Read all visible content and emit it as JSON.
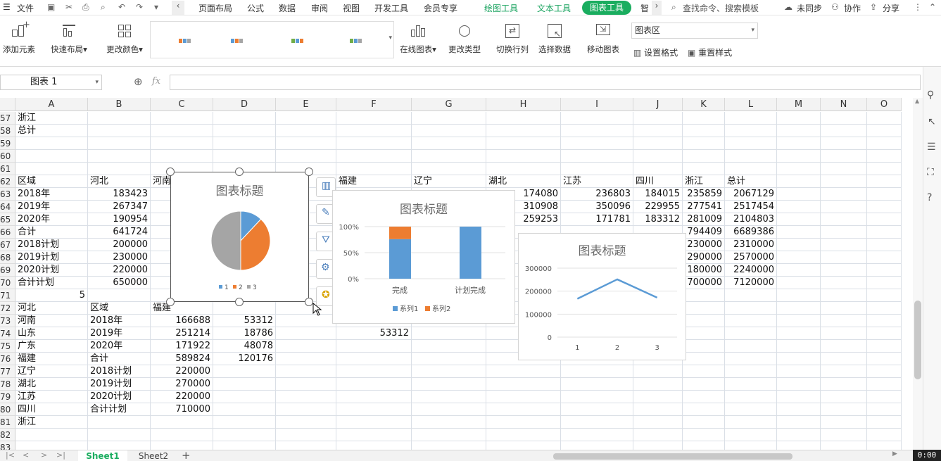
{
  "menubar": {
    "file": "文件",
    "tabs": [
      "页面布局",
      "公式",
      "数据",
      "审阅",
      "视图",
      "开发工具",
      "会员专享"
    ],
    "context_tabs": [
      "绘图工具",
      "文本工具"
    ],
    "active_context_tab": "图表工具",
    "more_tab": "智",
    "search_placeholder": "查找命令、搜索模板",
    "sync": "未同步",
    "collab": "协作",
    "share": "分享"
  },
  "ribbon": {
    "add_element": "添加元素",
    "quick_layout": "快速布局",
    "change_color": "更改颜色",
    "online_chart": "在线图表",
    "change_type": "更改类型",
    "switch_row_col": "切换行列",
    "select_data": "选择数据",
    "move_chart": "移动图表",
    "chart_area_select": "图表区",
    "set_format": "设置格式",
    "reset_style": "重置样式"
  },
  "formula": {
    "namebox": "图表 1",
    "fx": "fx"
  },
  "columns": [
    "A",
    "B",
    "C",
    "D",
    "E",
    "F",
    "G",
    "H",
    "I",
    "J",
    "K",
    "L",
    "M",
    "N",
    "O"
  ],
  "rows": [
    {
      "n": "57",
      "cells": [
        "浙江",
        "",
        "",
        "",
        "",
        "",
        "",
        "",
        "",
        "",
        "",
        ""
      ]
    },
    {
      "n": "58",
      "cells": [
        "总计",
        "",
        "",
        "",
        "",
        "",
        "",
        "",
        "",
        "",
        "",
        ""
      ]
    },
    {
      "n": "59",
      "cells": [
        "",
        "",
        "",
        "",
        "",
        "",
        "",
        "",
        "",
        "",
        "",
        ""
      ]
    },
    {
      "n": "60",
      "cells": [
        "",
        "",
        "",
        "",
        "",
        "",
        "",
        "",
        "",
        "",
        "",
        ""
      ]
    },
    {
      "n": "61",
      "cells": [
        "",
        "",
        "",
        "",
        "",
        "",
        "",
        "",
        "",
        "",
        "",
        ""
      ]
    },
    {
      "n": "62",
      "cells": [
        "区域",
        "河北",
        "河南",
        "",
        "",
        "福建",
        "辽宁",
        "湖北",
        "江苏",
        "四川",
        "浙江",
        "总计"
      ]
    },
    {
      "n": "63",
      "cells": [
        "2018年",
        "183423",
        "",
        "",
        "",
        "",
        "",
        "174080",
        "236803",
        "184015",
        "235859",
        "2067129"
      ]
    },
    {
      "n": "64",
      "cells": [
        "2019年",
        "267347",
        "",
        "",
        "",
        "",
        "",
        "310908",
        "350096",
        "229955",
        "277541",
        "2517454"
      ]
    },
    {
      "n": "65",
      "cells": [
        "2020年",
        "190954",
        "",
        "",
        "",
        "",
        "",
        "259253",
        "171781",
        "183312",
        "281009",
        "2104803"
      ]
    },
    {
      "n": "66",
      "cells": [
        "合计",
        "641724",
        "",
        "",
        "",
        "",
        "",
        "",
        "",
        "",
        "794409",
        "6689386"
      ]
    },
    {
      "n": "67",
      "cells": [
        "2018计划",
        "200000",
        "",
        "",
        "",
        "",
        "",
        "",
        "",
        "",
        "230000",
        "2310000"
      ]
    },
    {
      "n": "68",
      "cells": [
        "2019计划",
        "230000",
        "",
        "",
        "",
        "",
        "",
        "",
        "",
        "",
        "290000",
        "2570000"
      ]
    },
    {
      "n": "69",
      "cells": [
        "2020计划",
        "220000",
        "",
        "",
        "",
        "",
        "",
        "",
        "",
        "",
        "180000",
        "2240000"
      ]
    },
    {
      "n": "70",
      "cells": [
        "合计计划",
        "650000",
        "",
        "",
        "",
        "",
        "",
        "",
        "",
        "",
        "700000",
        "7120000"
      ]
    },
    {
      "n": "71",
      "cells": [
        "5",
        "",
        "",
        "",
        "",
        "",
        "",
        "",
        "",
        "",
        "",
        ""
      ]
    },
    {
      "n": "72",
      "cells": [
        "河北",
        "区域",
        "福建",
        "",
        "",
        "",
        "",
        "",
        "",
        "",
        "",
        ""
      ]
    },
    {
      "n": "73",
      "cells": [
        "河南",
        "2018年",
        "166688",
        "53312",
        "",
        "",
        "",
        "",
        "",
        "",
        "",
        ""
      ]
    },
    {
      "n": "74",
      "cells": [
        "山东",
        "2019年",
        "251214",
        "18786",
        "",
        "53312",
        "",
        "",
        "",
        "",
        "",
        ""
      ]
    },
    {
      "n": "75",
      "cells": [
        "广东",
        "2020年",
        "171922",
        "48078",
        "",
        "",
        "",
        "",
        "",
        "",
        "",
        ""
      ]
    },
    {
      "n": "76",
      "cells": [
        "福建",
        "合计",
        "589824",
        "120176",
        "",
        "",
        "",
        "",
        "",
        "",
        "",
        ""
      ]
    },
    {
      "n": "77",
      "cells": [
        "辽宁",
        "2018计划",
        "220000",
        "",
        "",
        "",
        "",
        "",
        "",
        "",
        "",
        ""
      ]
    },
    {
      "n": "78",
      "cells": [
        "湖北",
        "2019计划",
        "270000",
        "",
        "",
        "",
        "",
        "",
        "",
        "",
        "",
        ""
      ]
    },
    {
      "n": "79",
      "cells": [
        "江苏",
        "2020计划",
        "220000",
        "",
        "",
        "",
        "",
        "",
        "",
        "",
        "",
        ""
      ]
    },
    {
      "n": "80",
      "cells": [
        "四川",
        "合计计划",
        "710000",
        "",
        "",
        "",
        "",
        "",
        "",
        "",
        "",
        ""
      ]
    },
    {
      "n": "81",
      "cells": [
        "浙江",
        "",
        "",
        "",
        "",
        "",
        "",
        "",
        "",
        "",
        "",
        ""
      ]
    },
    {
      "n": "82",
      "cells": [
        "",
        "",
        "",
        "",
        "",
        "",
        "",
        "",
        "",
        "",
        "",
        ""
      ]
    },
    {
      "n": "83",
      "cells": [
        "",
        "",
        "",
        "",
        "",
        "",
        "",
        "",
        "",
        "",
        "",
        ""
      ]
    }
  ],
  "sheets": {
    "active": "Sheet1",
    "other": "Sheet2",
    "add": "+"
  },
  "clock": "0:00",
  "colors": {
    "blue": "#5b9bd5",
    "orange": "#ed7d31",
    "gray": "#a5a5a5",
    "green": "#1aad5f"
  },
  "chart_data": [
    {
      "type": "pie",
      "title": "图表标题",
      "categories": [
        "1",
        "2",
        "3"
      ],
      "values": [
        12,
        38,
        50
      ]
    },
    {
      "type": "bar",
      "title": "图表标题",
      "stacked_percent": true,
      "categories": [
        "完成",
        "计划完成"
      ],
      "y_ticks": [
        "100%",
        "50%",
        "0%"
      ],
      "series": [
        {
          "name": "系列1",
          "values": [
            76,
            100
          ]
        },
        {
          "name": "系列2",
          "values": [
            24,
            0
          ]
        }
      ],
      "legend": "bottom"
    },
    {
      "type": "line",
      "title": "图表标题",
      "categories": [
        "1",
        "2",
        "3"
      ],
      "y_ticks": [
        "300000",
        "200000",
        "100000",
        "0"
      ],
      "ylim": [
        0,
        300000
      ],
      "values": [
        166688,
        251214,
        171922
      ],
      "grid": true
    }
  ]
}
